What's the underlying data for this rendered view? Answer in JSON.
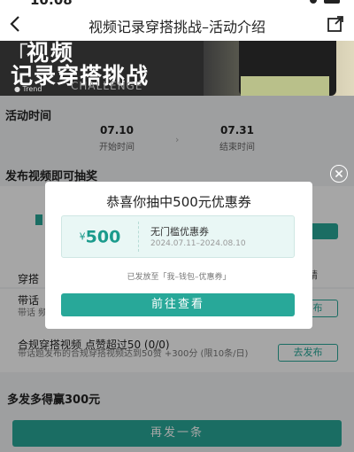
{
  "status": {
    "time": "10:08"
  },
  "nav": {
    "title": "视频记录穿搭挑战–活动介绍"
  },
  "hero": {
    "line1": "视频",
    "line2": "记录穿搭挑战",
    "tag": "Trend",
    "subtitle": "CHALLENGE"
  },
  "activity_time": {
    "title": "活动时间",
    "start_date": "07.10",
    "start_label": "开始时间",
    "end_date": "07.31",
    "end_label": "结束时间"
  },
  "lottery": {
    "title": "发布视频即可抽奖"
  },
  "tasks": [
    {
      "name": "穿搭",
      "desc": "",
      "button": "加精"
    },
    {
      "name": "带话",
      "desc": "带话 频。",
      "button": "去发布"
    },
    {
      "name": "合规穿搭视频 点赞超过50 (0/0)",
      "desc": "带话题发布的合规穿搭视频达到50赞 +300分 (限10条/日)",
      "button": "去发布"
    }
  ],
  "bottom": {
    "title": "多发多得赢300元",
    "button": "再发一条"
  },
  "modal": {
    "title": "恭喜你抽中500元优惠券",
    "currency": "¥",
    "amount": "500",
    "coupon_name": "无门槛优惠券",
    "coupon_range": "2024.07.11–2024.08.10",
    "note": "已发放至「我–钱包–优惠券」",
    "button": "前往查看"
  },
  "colors": {
    "accent": "#28a899",
    "overlay": "rgba(0,0,0,0.35)"
  }
}
